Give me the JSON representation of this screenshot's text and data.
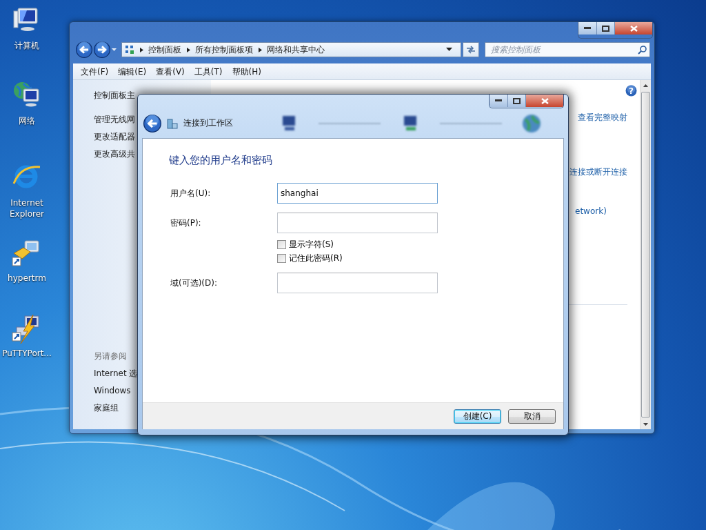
{
  "desktop_icons": [
    {
      "label": "计算机",
      "kind": "computer"
    },
    {
      "label": "网络",
      "kind": "network"
    },
    {
      "label": "Internet Explorer",
      "kind": "browser"
    },
    {
      "label": "hypertrm",
      "kind": "phone"
    },
    {
      "label": "PuTTYPort...",
      "kind": "terminal"
    }
  ],
  "explorer": {
    "breadcrumb": [
      "控制面板",
      "所有控制面板项",
      "网络和共享中心"
    ],
    "search": {
      "placeholder": "搜索控制面板"
    },
    "menu": [
      "文件(F)",
      "编辑(E)",
      "查看(V)",
      "工具(T)",
      "帮助(H)"
    ],
    "sidebar": {
      "links": [
        "控制面板主",
        "管理无线网",
        "更改适配器",
        "更改高级共"
      ],
      "see_also_title": "另请参阅",
      "see_also": [
        "Internet 选",
        "Windows",
        "家庭组"
      ]
    },
    "help": "?",
    "content_links": [
      "查看完整映射",
      "连接或断开连接",
      "etwork)"
    ]
  },
  "dialog": {
    "title": "连接到工作区",
    "heading": "键入您的用户名和密码",
    "rows": [
      {
        "kind": "field",
        "label": "用户名(U):",
        "value": "shanghai",
        "focused": true
      },
      {
        "kind": "field",
        "label": "密码(P):",
        "focused": false
      },
      {
        "kind": "checkbox",
        "label": "显示字符(S)",
        "checked": false
      },
      {
        "kind": "checkbox",
        "label": "记住此密码(R)",
        "checked": false
      },
      {
        "kind": "field",
        "label": "域(可选)(D):",
        "focused": false
      }
    ],
    "buttons": [
      {
        "label": "创建(C)",
        "default": true
      },
      {
        "label": "取消",
        "default": false
      }
    ]
  }
}
